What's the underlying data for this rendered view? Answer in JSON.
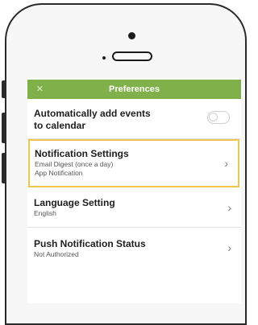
{
  "topbar": {
    "close_glyph": "×",
    "title": "Preferences",
    "accent_color": "#7fb04a"
  },
  "settings": [
    {
      "title_line1": "Automatically add events",
      "title_line2": "to calendar",
      "toggle_on": false
    },
    {
      "title": "Notification Settings",
      "sub1": "Email Digest (once a day)",
      "sub2": "App Notification",
      "highlighted": true,
      "highlight_color": "#f0c64a"
    },
    {
      "title": "Language Setting",
      "sub1": "English"
    },
    {
      "title": "Push Notification Status",
      "sub1": "Not Authorized"
    }
  ],
  "chevron_glyph": "›"
}
